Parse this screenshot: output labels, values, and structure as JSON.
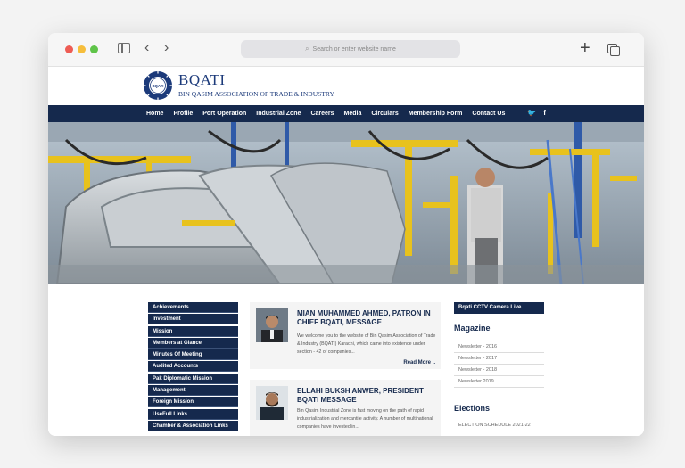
{
  "browser": {
    "address_placeholder": "Search or enter website name"
  },
  "site": {
    "brand": "BQATI",
    "brand_sub": "BIN QASIM ASSOCIATION OF TRADE & INDUSTRY",
    "logo_text": "BQATI",
    "nav": [
      "Home",
      "Profile",
      "Port Operation",
      "Industrial Zone",
      "Careers",
      "Media",
      "Circulars",
      "Membership Form",
      "Contact Us"
    ],
    "social": [
      "twitter-icon",
      "facebook-icon"
    ],
    "social_glyphs": [
      "🐦",
      "f"
    ]
  },
  "sidebar": {
    "items": [
      "Achievements",
      "Investment",
      "Mission",
      "Members at Glance",
      "Minutes Of Meeting",
      "Audited Accounts",
      "Pak Diplomatic Mission",
      "Management",
      "Foreign Mission",
      "UseFull Links",
      "Chamber & Association Links"
    ]
  },
  "messages": [
    {
      "title": "MIAN MUHAMMED AHMED, PATRON IN CHIEF BQATI, MESSAGE",
      "body": "We welcome you to the website of Bin Qasim Association of Trade & Industry (BQATI) Karachi, which came into existence under section - 42 of companies...",
      "more": "Read More .."
    },
    {
      "title": "ELLAHI BUKSH ANWER, PRESIDENT BQATI MESSAGE",
      "body": "Bin Qasim Industrial Zone is fast moving on the path of rapid industrialization and mercantile activity. A number of multinational companies have invested in..."
    }
  ],
  "right": {
    "cctv": "Bqati CCTV Camera Live",
    "magazine_heading": "Magazine",
    "newsletters": [
      "Newsletter - 2016",
      "Newsletter - 2017",
      "Newsletter - 2018",
      "Newsletter 2019"
    ],
    "elections_heading": "Elections",
    "elections": [
      "ELECTION SCHEDULE 2021-22"
    ]
  },
  "colors": {
    "navy": "#15294d",
    "brand_blue": "#1c3a7a",
    "hero_yellow": "#e8c21d"
  }
}
